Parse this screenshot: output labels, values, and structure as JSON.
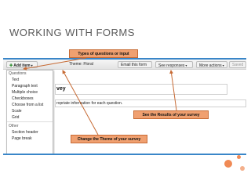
{
  "slide": {
    "title": "WORKING WITH FORMS"
  },
  "toolbar": {
    "add_item": "Add item",
    "theme": "Theme: Floral",
    "email": "Email this form",
    "responses": "See responses",
    "more": "More actions",
    "saved": "Saved"
  },
  "menu": {
    "questions_heading": "Questions",
    "question_items": [
      "Text",
      "Paragraph text",
      "Multiple choice",
      "Checkboxes",
      "Choose from a list",
      "Scale",
      "Grid"
    ],
    "other_heading": "Other",
    "other_items": [
      "Section header",
      "Page break"
    ]
  },
  "form": {
    "title_fragment": "vey",
    "description_fragment": "ropriate information for each question."
  },
  "callouts": {
    "types": "Types of questions or input",
    "results": "See the Results of your survey",
    "theme": "Change the Theme of your survey"
  },
  "colors": {
    "accent": "#3a86c8",
    "callout": "#f0a070",
    "arrow": "#c76b35",
    "decor": "#f08a55"
  }
}
